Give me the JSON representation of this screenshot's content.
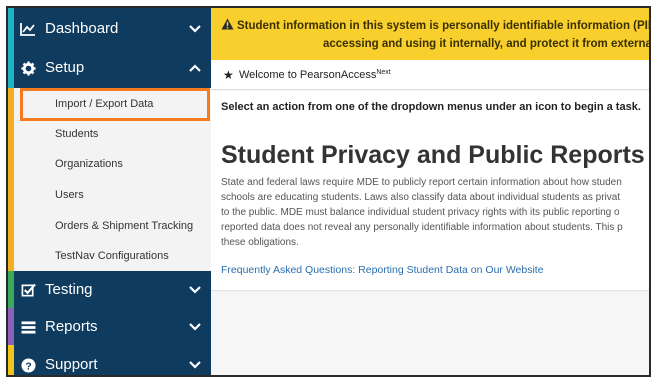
{
  "sidebar": {
    "main_items": [
      {
        "label": "Dashboard",
        "icon": "line-chart-icon",
        "chevron": "chevron-down-icon"
      },
      {
        "label": "Setup",
        "icon": "gear-icon",
        "chevron": "chevron-up-icon"
      },
      {
        "label": "Testing",
        "icon": "checkbox-icon",
        "chevron": "chevron-down-icon"
      },
      {
        "label": "Reports",
        "icon": "reports-icon",
        "chevron": "chevron-down-icon"
      },
      {
        "label": "Support",
        "icon": "question-circle-icon",
        "chevron": "chevron-down-icon"
      }
    ],
    "setup_subitems": [
      "Import / Export Data",
      "Students",
      "Organizations",
      "Users",
      "Orders & Shipment Tracking",
      "TestNav Configurations"
    ],
    "accent_colors": [
      "#1db4c8",
      "#f2b01e",
      "#3aaa5c",
      "#8a63b8",
      "#f0c419"
    ],
    "background_color": "#0f3b5f",
    "highlight_color": "#f47b20"
  },
  "banner": {
    "icon": "warning-icon",
    "line1": "Student information in this system is personally identifiable information (PII); ens",
    "line2": "accessing and using it internally, and protect it from external acc",
    "color": "#f8cf2c"
  },
  "welcome": {
    "icon": "star-icon",
    "text": "Welcome to PearsonAccess",
    "superscript": "Next"
  },
  "content": {
    "instruction": "Select an action from one of the dropdown menus under an icon to begin a task.",
    "title": "Student Privacy and Public Reports",
    "paragraph_lines": [
      "State and federal laws require MDE to publicly report certain information about how studen",
      "schools are educating students. Laws also classify data about individual students as privat",
      "to the public. MDE must balance individual student privacy rights with its public reporting o",
      "reported data does not reveal any personally identifiable information about students. This p",
      "these obligations."
    ],
    "link": "Frequently Asked Questions: Reporting Student Data on Our Website",
    "link_color": "#2a6fb0"
  }
}
